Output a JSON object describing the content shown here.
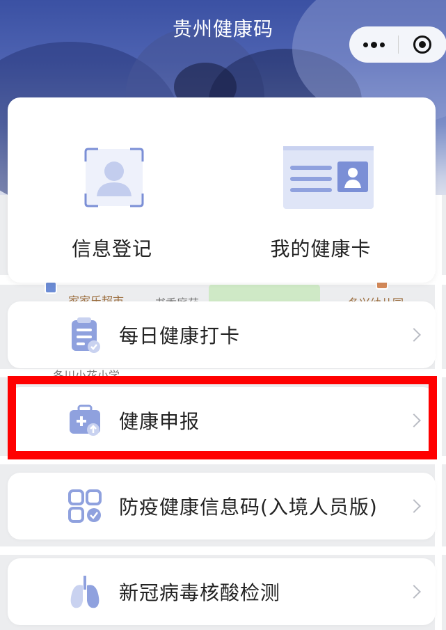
{
  "header": {
    "title": "贵州健康码",
    "more_icon": "more-dots-icon",
    "close_icon": "target-circle-icon"
  },
  "quick_actions": [
    {
      "label": "信息登记",
      "icon": "person-id-icon"
    },
    {
      "label": "我的健康卡",
      "icon": "health-card-icon"
    }
  ],
  "menu": [
    {
      "label": "每日健康打卡",
      "icon": "clipboard-check-icon"
    },
    {
      "label": "健康申报",
      "icon": "medical-kit-icon"
    },
    {
      "label": "防疫健康信息码(入境人员版)",
      "icon": "qr-grid-icon"
    },
    {
      "label": "新冠病毒核酸检测",
      "icon": "lungs-icon"
    }
  ],
  "map_labels": [
    "家家乐超市",
    "书香庭苑",
    "冬兴幼儿园",
    "冬川小花小学"
  ],
  "colors": {
    "accent": "#7b8fd6",
    "icon_light": "#dfe5f7",
    "highlight": "#ff0000"
  }
}
